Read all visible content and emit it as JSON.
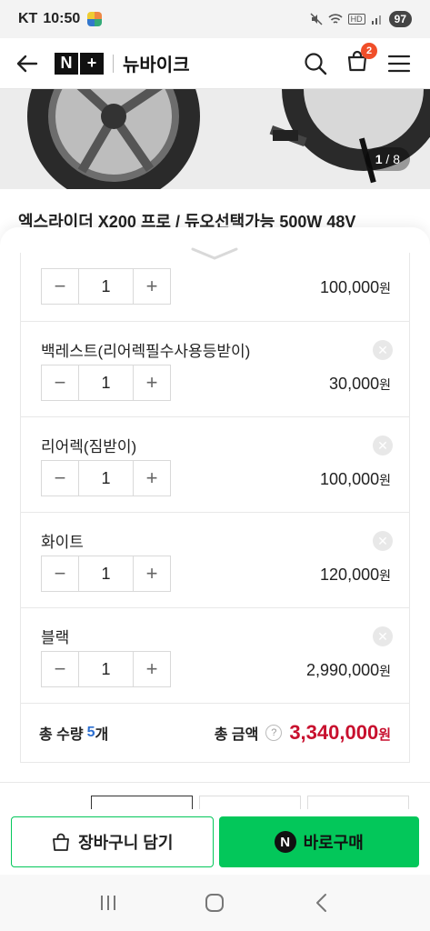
{
  "status_bar": {
    "carrier": "KT",
    "time": "10:50",
    "battery": "97"
  },
  "header": {
    "logo_n": "N",
    "logo_plus": "+",
    "brand": "뉴바이크",
    "cart_count": "2"
  },
  "gallery": {
    "current": "1",
    "total": "/ 8"
  },
  "product": {
    "title": "엑스라이더 X200 프로 / 듀오선택가능 500W 48V"
  },
  "options": [
    {
      "name": "",
      "qty": "1",
      "price": "100,000",
      "unit": "원"
    },
    {
      "name": "백레스트(리어렉필수사용등받이)",
      "qty": "1",
      "price": "30,000",
      "unit": "원"
    },
    {
      "name": "리어렉(짐받이)",
      "qty": "1",
      "price": "100,000",
      "unit": "원"
    },
    {
      "name": "화이트",
      "qty": "1",
      "price": "120,000",
      "unit": "원"
    },
    {
      "name": "블랙",
      "qty": "1",
      "price": "2,990,000",
      "unit": "원"
    }
  ],
  "summary": {
    "qty_label": "총 수량",
    "qty_value": "5",
    "qty_unit": "개",
    "amount_label": "총 금액",
    "amount": "3,340,000",
    "amount_unit": "원"
  },
  "actions": {
    "cart_label": "장바구니 담기",
    "buy_label": "바로구매",
    "npay_glyph": "N"
  },
  "colors": {
    "accent_green": "#03c75a",
    "price_red": "#c8102e",
    "badge": "#f04e29",
    "count_blue": "#2c6fd1"
  }
}
